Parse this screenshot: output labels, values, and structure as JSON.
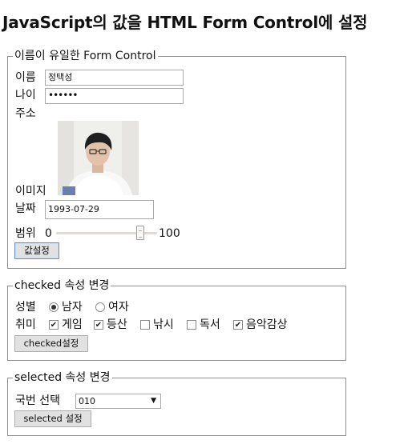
{
  "page_title": "JavaScript의 값을 HTML Form Control에 설정",
  "form_controls": {
    "legend": "이름이 유일한 Form Control",
    "name_label": "이름",
    "name_value": "정택성",
    "age_label": "나이",
    "age_value": "••••••",
    "address_label": "주소",
    "image_label": "이미지",
    "date_label": "날짜",
    "date_value": "1993-07-29",
    "range_label": "범위",
    "range_min": "0",
    "range_max": "100",
    "range_value": 85,
    "button_label": "값설정"
  },
  "checked_section": {
    "legend": "checked 속성 변경",
    "gender_label": "성별",
    "gender_options": [
      {
        "label": "남자",
        "checked": true
      },
      {
        "label": "여자",
        "checked": false
      }
    ],
    "hobby_label": "취미",
    "hobby_options": [
      {
        "label": "게임",
        "checked": true
      },
      {
        "label": "등산",
        "checked": true
      },
      {
        "label": "낚시",
        "checked": false
      },
      {
        "label": "독서",
        "checked": false
      },
      {
        "label": "음악감상",
        "checked": true
      }
    ],
    "button_label": "checked설정"
  },
  "selected_section": {
    "legend": "selected 속성 변경",
    "select_label": "국번 선택",
    "select_value": "010",
    "button_label": "selected 설정"
  }
}
